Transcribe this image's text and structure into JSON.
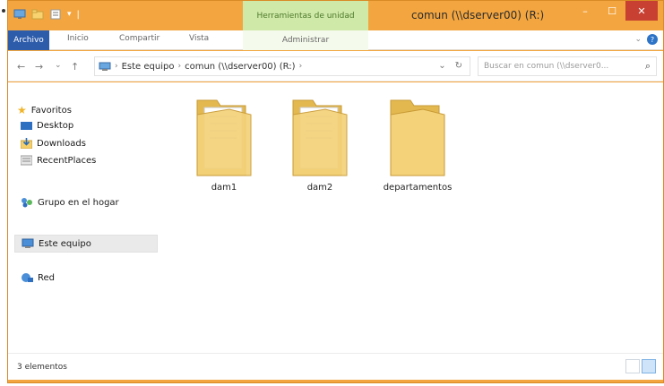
{
  "window": {
    "title": "comun (\\\\dserver00) (R:)",
    "contextual_tab_group": "Herramientas de unidad",
    "controls": {
      "minimize": "–",
      "maximize": "☐",
      "close": "✕"
    }
  },
  "ribbon": {
    "tabs": [
      {
        "label": "Archivo"
      },
      {
        "label": "Inicio"
      },
      {
        "label": "Compartir"
      },
      {
        "label": "Vista"
      },
      {
        "label": "Administrar"
      }
    ],
    "expand_glyph": "⌄",
    "help_glyph": "?"
  },
  "address": {
    "back_glyph": "←",
    "forward_glyph": "→",
    "recent_glyph": "⌄",
    "up_glyph": "↑",
    "breadcrumb": [
      "Este equipo",
      "comun (\\\\dserver00) (R:)"
    ],
    "sep_glyph": "›",
    "dropdown_glyph": "⌄",
    "refresh_glyph": "↻"
  },
  "search": {
    "placeholder": "Buscar en comun (\\\\dserver0... ",
    "icon": "search-icon",
    "glyph": "⌕"
  },
  "nav_pane": {
    "favorites": "Favoritos",
    "favorites_items": [
      "Desktop",
      "Downloads",
      "RecentPlaces"
    ],
    "homegroup": "Grupo en el hogar",
    "this_pc": "Este equipo",
    "network": "Red"
  },
  "folders": [
    {
      "name": "dam1",
      "has_content": true
    },
    {
      "name": "dam2",
      "has_content": true
    },
    {
      "name": "departamentos",
      "has_content": false
    }
  ],
  "status": {
    "item_count": "3 elementos"
  },
  "colors": {
    "titlebar": "#f3a640",
    "file_tab": "#2d5cab",
    "contextual_tab": "#cfe9a8",
    "close_button": "#c84031",
    "folder_yellow": "#f3d27a"
  }
}
